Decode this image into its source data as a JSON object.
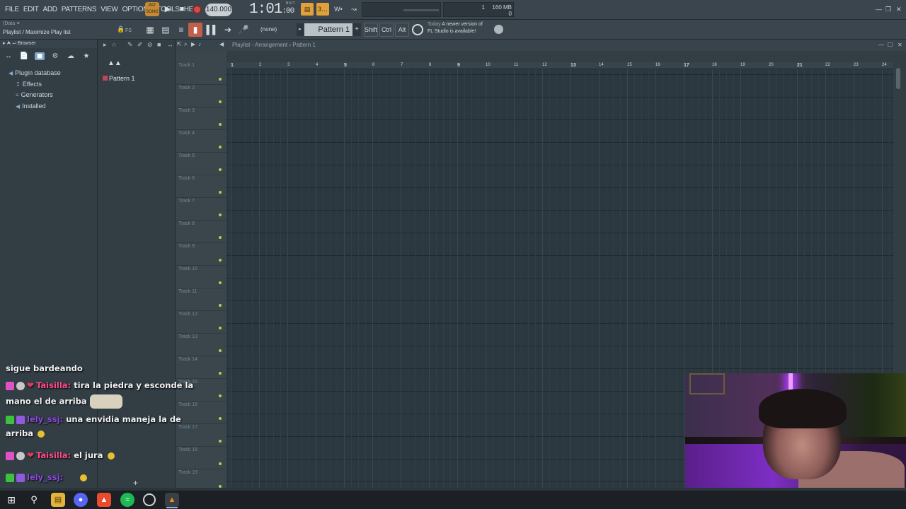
{
  "menu": {
    "items": [
      "FILE",
      "EDIT",
      "ADD",
      "PATTERNS",
      "VIEW",
      "OPTIONS",
      "TOOLS",
      "HELP"
    ]
  },
  "transport": {
    "pat_song_label": "PAT",
    "pat_song_sub": "SONG",
    "play_icon": "play-icon",
    "stop_icon": "stop-icon",
    "record_icon": "record-icon",
    "tempo": "140.000",
    "time_main": "1:01",
    "time_sub": ":00",
    "time_sig": "B:S:T",
    "cpu_value": "1",
    "memory": "160 MB",
    "polyphony": "0"
  },
  "toolbar": {
    "hint_line1": "(Data ⏷",
    "hint_line2": "Playlist / Maximize Play list",
    "fs_label": "FS",
    "none_label": "(none)",
    "pattern_select": "Pattern 1",
    "shift_label": "Shift",
    "ctrl_label": "Ctrl",
    "alt_label": "Alt",
    "news_prefix": "Today",
    "news_line1": "A newer version of",
    "news_line2": "FL Studio is available!"
  },
  "browser": {
    "title": "Browser",
    "items": [
      {
        "label": "Plugin database",
        "icon": "plugin-icon"
      },
      {
        "label": "Effects",
        "icon": "effects-icon"
      },
      {
        "label": "Generators",
        "icon": "generators-icon"
      },
      {
        "label": "Installed",
        "icon": "installed-icon"
      }
    ]
  },
  "picker": {
    "patterns": [
      "Pattern 1"
    ]
  },
  "playlist": {
    "title": "Playlist - Arrangement › Pattern 1",
    "tracks": [
      "Track 1",
      "Track 2",
      "Track 3",
      "Track 4",
      "Track 5",
      "Track 6",
      "Track 7",
      "Track 8",
      "Track 9",
      "Track 10",
      "Track 11",
      "Track 12",
      "Track 13",
      "Track 14",
      "Track 15",
      "Track 16",
      "Track 17",
      "Track 18",
      "Track 19"
    ],
    "ruler": [
      "1",
      "2",
      "3",
      "4",
      "5",
      "6",
      "7",
      "8",
      "9",
      "10",
      "11",
      "12",
      "13",
      "14",
      "15",
      "16",
      "17",
      "18",
      "19",
      "20",
      "21",
      "22",
      "23",
      "24"
    ]
  },
  "chat": {
    "messages": [
      {
        "user": "",
        "text": "sigue bardeando"
      },
      {
        "user": "Taisilla:",
        "text": "tira la piedra y esconde la"
      },
      {
        "user": "",
        "text": "mano el de arriba"
      },
      {
        "user": "lely_ssj:",
        "text": "una envidia maneja la de"
      },
      {
        "user": "",
        "text": "arriba"
      },
      {
        "user": "Taisilla:",
        "text": "el jura"
      },
      {
        "user": "lely_ssj:",
        "text": ""
      }
    ]
  },
  "taskbar": {
    "apps": [
      "start-icon",
      "search-icon",
      "file-explorer-icon",
      "discord-icon",
      "brave-icon",
      "spotify-icon",
      "clock-icon",
      "fl-studio-icon"
    ]
  }
}
